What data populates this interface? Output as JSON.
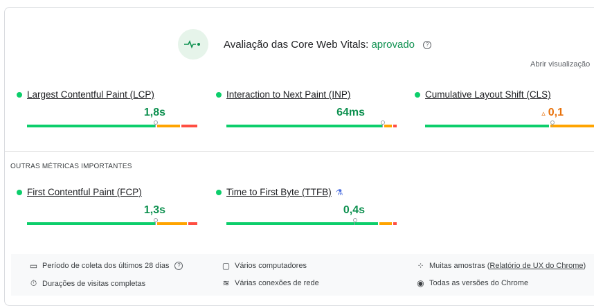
{
  "header": {
    "title": "Avaliação das Core Web Vitals:",
    "status": "aprovado",
    "expand_link": "Abrir visualização"
  },
  "core_metrics": [
    {
      "title": "Largest Contentful Paint (LCP)",
      "value": "1,8s",
      "status": "good",
      "distribution": {
        "good": 0.76,
        "needs_improvement": 0.14,
        "poor": 0.1
      },
      "marker": 0.75
    },
    {
      "title": "Interaction to Next Paint (INP)",
      "value": "64ms",
      "status": "good",
      "distribution": {
        "good": 0.92,
        "needs_improvement": 0.05,
        "poor": 0.03
      },
      "marker": 0.91
    },
    {
      "title": "Cumulative Layout Shift (CLS)",
      "value": "0,1",
      "status": "needs-improvement",
      "distribution": {
        "good": 0.73,
        "needs_improvement": 0.27,
        "poor": 0.0
      },
      "marker": 0.74
    }
  ],
  "other_section_title": "OUTRAS MÉTRICAS IMPORTANTES",
  "other_metrics": [
    {
      "title": "First Contentful Paint (FCP)",
      "value": "1,3s",
      "status": "good",
      "distribution": {
        "good": 0.76,
        "needs_improvement": 0.18,
        "poor": 0.06
      },
      "marker": 0.75
    },
    {
      "title": "Time to First Byte (TTFB)",
      "value": "0,4s",
      "status": "good",
      "distribution": {
        "good": 0.89,
        "needs_improvement": 0.08,
        "poor": 0.03
      },
      "marker": 0.75,
      "experimental": true
    }
  ],
  "footer": {
    "period": "Período de coleta dos últimos 28 dias",
    "devices": "Vários computadores",
    "samples_prefix": "Muitas amostras (",
    "samples_link": "Relatório de UX do Chrome",
    "samples_suffix": ")",
    "visits": "Durações de visitas completas",
    "network": "Várias conexões de rede",
    "versions": "Todas as versões do Chrome"
  },
  "colors": {
    "good": "#0cce6b",
    "needs_improvement": "#ffa400",
    "poor": "#ff4e42",
    "pass_text": "#0d904f"
  }
}
